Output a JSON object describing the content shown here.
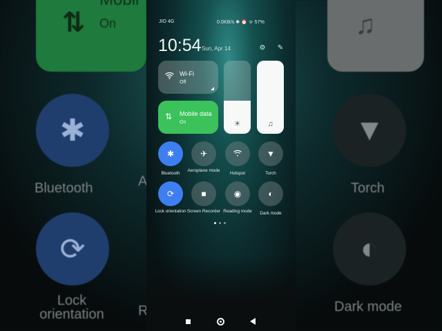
{
  "background": {
    "mobile_data": {
      "title": "Mobil",
      "state": "On"
    },
    "labels": {
      "bluetooth": "Bluetooth",
      "torch": "Torch",
      "lock": "Lock orientation",
      "dark_mode": "Dark mode",
      "aeroplane_partial": "A",
      "reading_partial": "R"
    }
  },
  "status_bar": {
    "carrier": "JIO 4G",
    "right_text": "0.0KB/s ✱ ⏰ ᯤ 57%",
    "battery_percent": 57
  },
  "header": {
    "time": "10:54",
    "date": "Sun, Apr 14",
    "settings_icon": "gear-icon",
    "edit_icon": "edit-icon"
  },
  "tiles": {
    "wifi": {
      "name": "Wi-Fi",
      "state": "Off",
      "icon": "wifi-icon"
    },
    "mobile_data": {
      "name": "Mobile data",
      "state": "On",
      "icon": "data-arrows-icon",
      "color": "#3bc25a"
    }
  },
  "sliders": {
    "brightness": {
      "level": 0.45,
      "icon": "sun-icon"
    },
    "volume": {
      "level": 1.0,
      "icon": "music-note-icon"
    }
  },
  "toggles": [
    {
      "label": "Bluetooth",
      "icon": "bluetooth-icon",
      "on": true
    },
    {
      "label": "Aeroplane mode",
      "icon": "airplane-icon",
      "on": false
    },
    {
      "label": "Hotspot",
      "icon": "hotspot-icon",
      "on": false
    },
    {
      "label": "Torch",
      "icon": "torch-icon",
      "on": false
    },
    {
      "label": "Lock orientation",
      "icon": "rotation-lock-icon",
      "on": true
    },
    {
      "label": "Screen Recorder",
      "icon": "video-camera-icon",
      "on": false
    },
    {
      "label": "Reading mode",
      "icon": "eye-icon",
      "on": false
    },
    {
      "label": "Dark mode",
      "icon": "dark-mode-icon",
      "on": false
    }
  ],
  "pager": {
    "pages": 3,
    "current": 1
  },
  "accent_color": "#3d7ff0"
}
